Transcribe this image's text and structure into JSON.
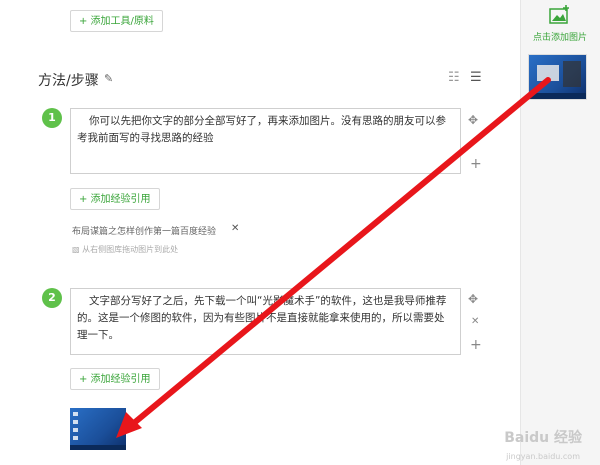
{
  "top_button": {
    "label": "+ 添加工具/原料"
  },
  "section": {
    "title": "方法/步骤"
  },
  "steps": [
    {
      "number": "1",
      "text": "你可以先把你文字的部分全部写好了，再来添加图片。没有思路的朋友可以参考我前面写的寻找思路的经验",
      "ref_button": "+ 添加经验引用",
      "ref_title": "布局谋篇之怎样创作第一篇百度经验",
      "drop_hint": "从右侧图库拖动图片到此处"
    },
    {
      "number": "2",
      "text": "文字部分写好了之后，先下载一个叫“光影魔术手”的软件，这也是我导师推荐的。这是一个修图的软件，因为有些图片不是直接就能拿来使用的，所以需要处理一下。",
      "ref_button": "+ 添加经验引用"
    }
  ],
  "sidebar": {
    "add_image_label": "点击添加图片"
  },
  "watermark": {
    "brand": "Baidu 经验",
    "url": "jingyan.baidu.com"
  },
  "colors": {
    "accent": "#3aa53a",
    "step_badge": "#5fc14a",
    "arrow": "#e8161b"
  }
}
